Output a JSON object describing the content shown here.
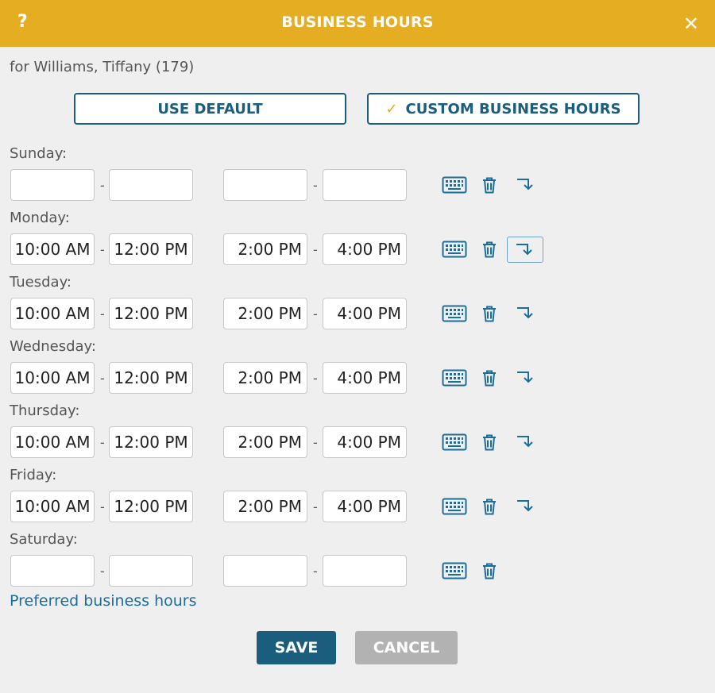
{
  "header": {
    "help": "?",
    "title": "BUSINESS HOURS",
    "close": "✕"
  },
  "subtitle": "for Williams, Tiffany (179)",
  "modes": {
    "default_label": "USE DEFAULT",
    "custom_label": "CUSTOM BUSINESS HOURS",
    "custom_check": "✓"
  },
  "dash": "-",
  "days": [
    {
      "label": "Sunday:",
      "start1": "",
      "end1": "",
      "start2": "",
      "end2": "",
      "copy": true
    },
    {
      "label": "Monday:",
      "start1": "10:00 AM",
      "end1": "12:00 PM",
      "start2": "2:00 PM",
      "end2": "4:00 PM",
      "copy": true
    },
    {
      "label": "Tuesday:",
      "start1": "10:00 AM",
      "end1": "12:00 PM",
      "start2": "2:00 PM",
      "end2": "4:00 PM",
      "copy": true
    },
    {
      "label": "Wednesday:",
      "start1": "10:00 AM",
      "end1": "12:00 PM",
      "start2": "2:00 PM",
      "end2": "4:00 PM",
      "copy": true
    },
    {
      "label": "Thursday:",
      "start1": "10:00 AM",
      "end1": "12:00 PM",
      "start2": "2:00 PM",
      "end2": "4:00 PM",
      "copy": true
    },
    {
      "label": "Friday:",
      "start1": "10:00 AM",
      "end1": "12:00 PM",
      "start2": "2:00 PM",
      "end2": "4:00 PM",
      "copy": true
    },
    {
      "label": "Saturday:",
      "start1": "",
      "end1": "",
      "start2": "",
      "end2": "",
      "copy": false
    }
  ],
  "icons": {
    "keyboard": "keyboard-icon",
    "delete": "trash-icon",
    "copy": "copy-down-arrow-icon"
  },
  "preferred_link": "Preferred business hours",
  "footer": {
    "save_label": "SAVE",
    "cancel_label": "CANCEL"
  },
  "colors": {
    "header_bg": "#e5ae22",
    "primary": "#1b5d7d",
    "link": "#1b6e9a",
    "cancel_bg": "#b2b2b2"
  }
}
